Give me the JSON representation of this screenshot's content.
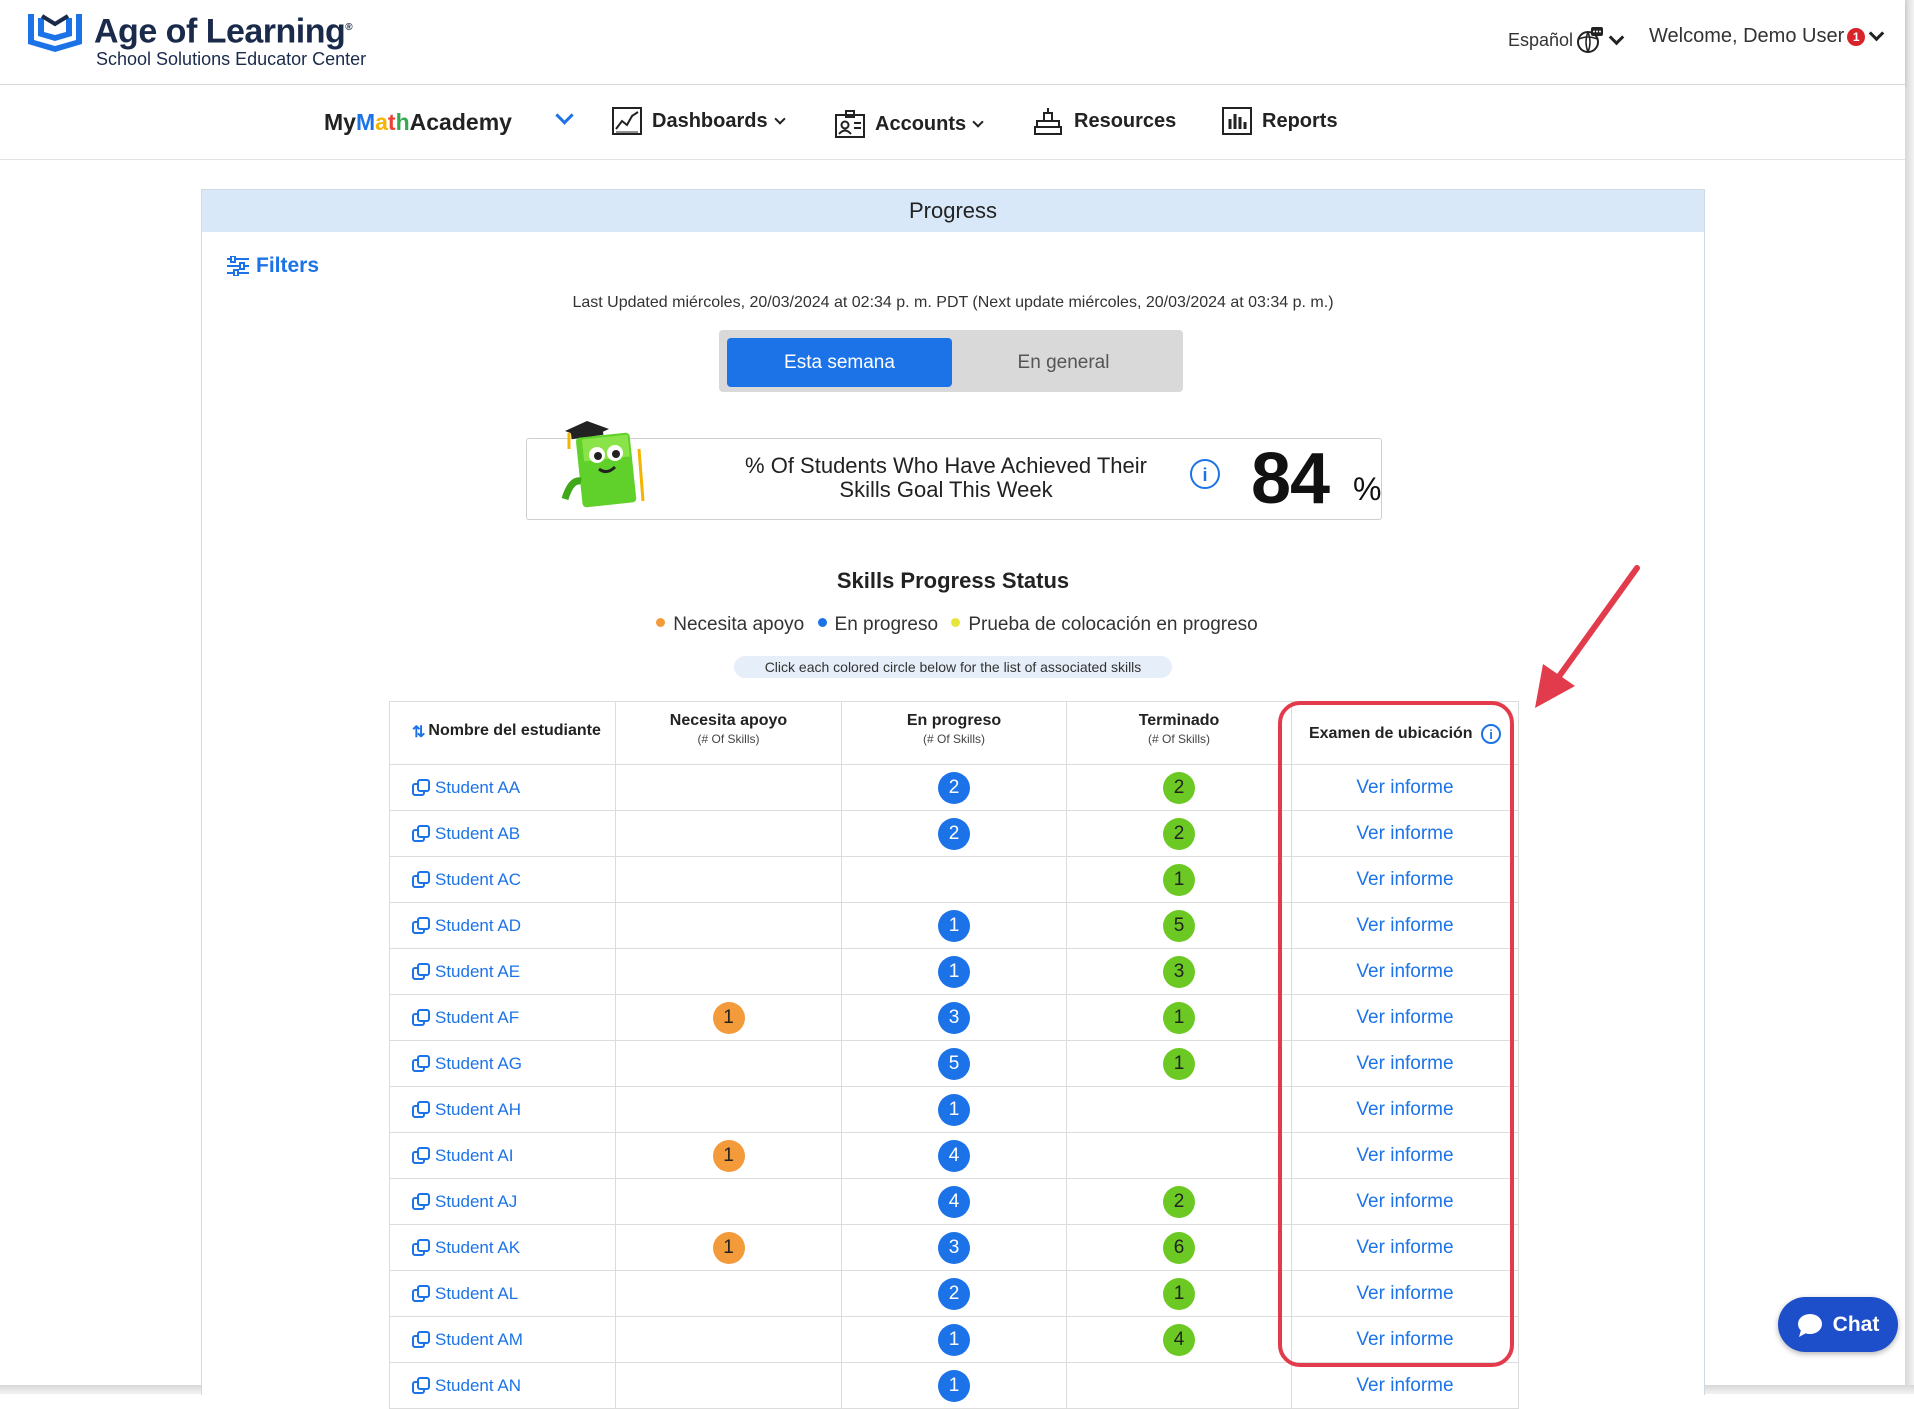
{
  "header": {
    "logo_title": "Age of Learning",
    "logo_registered": "®",
    "logo_subtitle": "School Solutions Educator Center",
    "language_label": "Español",
    "welcome_label": "Welcome, Demo User",
    "notification_count": "1"
  },
  "nav": {
    "brand_my": "My ",
    "brand_m": "M",
    "brand_a": "a",
    "brand_t": "t",
    "brand_h": "h",
    "brand_rest": " Academy",
    "dashboards": "Dashboards",
    "accounts": "Accounts",
    "resources": "Resources",
    "reports": "Reports"
  },
  "panel": {
    "title": "Progress",
    "filters_label": "Filters",
    "last_updated": "Last Updated miércoles, 20/03/2024 at 02:34 p. m. PDT (Next update miércoles, 20/03/2024 at 03:34 p. m.)",
    "toggle_active": "Esta semana",
    "toggle_inactive": "En general",
    "goal_text": "% Of Students Who Have Achieved Their Skills Goal This Week",
    "goal_value": "84",
    "goal_unit": "%",
    "info_glyph": "i",
    "skills_title": "Skills Progress Status",
    "legend": [
      {
        "label": "Necesita apoyo",
        "color": "#f39a3b"
      },
      {
        "label": "En progreso",
        "color": "#1c73e8"
      },
      {
        "label": "Prueba de colocación en progreso",
        "color": "#e6e63a"
      }
    ],
    "hint": "Click each colored circle below for the list of associated skills"
  },
  "table": {
    "col_student": "Nombre del estudiante",
    "col_needs_support": "Necesita apoyo",
    "col_in_progress": "En progreso",
    "col_completed": "Terminado",
    "col_placement": "Examen de ubicación",
    "col_sub": "(# Of Skills)",
    "rows": [
      {
        "name": "Student AA",
        "needs": "",
        "progress": "2",
        "done": "2",
        "report": "Ver informe"
      },
      {
        "name": "Student AB",
        "needs": "",
        "progress": "2",
        "done": "2",
        "report": "Ver informe"
      },
      {
        "name": "Student AC",
        "needs": "",
        "progress": "",
        "done": "1",
        "report": "Ver informe"
      },
      {
        "name": "Student AD",
        "needs": "",
        "progress": "1",
        "done": "5",
        "report": "Ver informe"
      },
      {
        "name": "Student AE",
        "needs": "",
        "progress": "1",
        "done": "3",
        "report": "Ver informe"
      },
      {
        "name": "Student AF",
        "needs": "1",
        "progress": "3",
        "done": "1",
        "report": "Ver informe"
      },
      {
        "name": "Student AG",
        "needs": "",
        "progress": "5",
        "done": "1",
        "report": "Ver informe"
      },
      {
        "name": "Student AH",
        "needs": "",
        "progress": "1",
        "done": "",
        "report": "Ver informe"
      },
      {
        "name": "Student AI",
        "needs": "1",
        "progress": "4",
        "done": "",
        "report": "Ver informe"
      },
      {
        "name": "Student AJ",
        "needs": "",
        "progress": "4",
        "done": "2",
        "report": "Ver informe"
      },
      {
        "name": "Student AK",
        "needs": "1",
        "progress": "3",
        "done": "6",
        "report": "Ver informe"
      },
      {
        "name": "Student AL",
        "needs": "",
        "progress": "2",
        "done": "1",
        "report": "Ver informe"
      },
      {
        "name": "Student AM",
        "needs": "",
        "progress": "1",
        "done": "4",
        "report": "Ver informe"
      },
      {
        "name": "Student AN",
        "needs": "",
        "progress": "1",
        "done": "",
        "report": "Ver informe"
      }
    ]
  },
  "chat": {
    "label": "Chat"
  },
  "colors": {
    "accent": "#1c73e8",
    "needs_support": "#f39a3b",
    "completed": "#6cc924",
    "annotation": "#e23b4b",
    "chat": "#1c4fc9"
  }
}
